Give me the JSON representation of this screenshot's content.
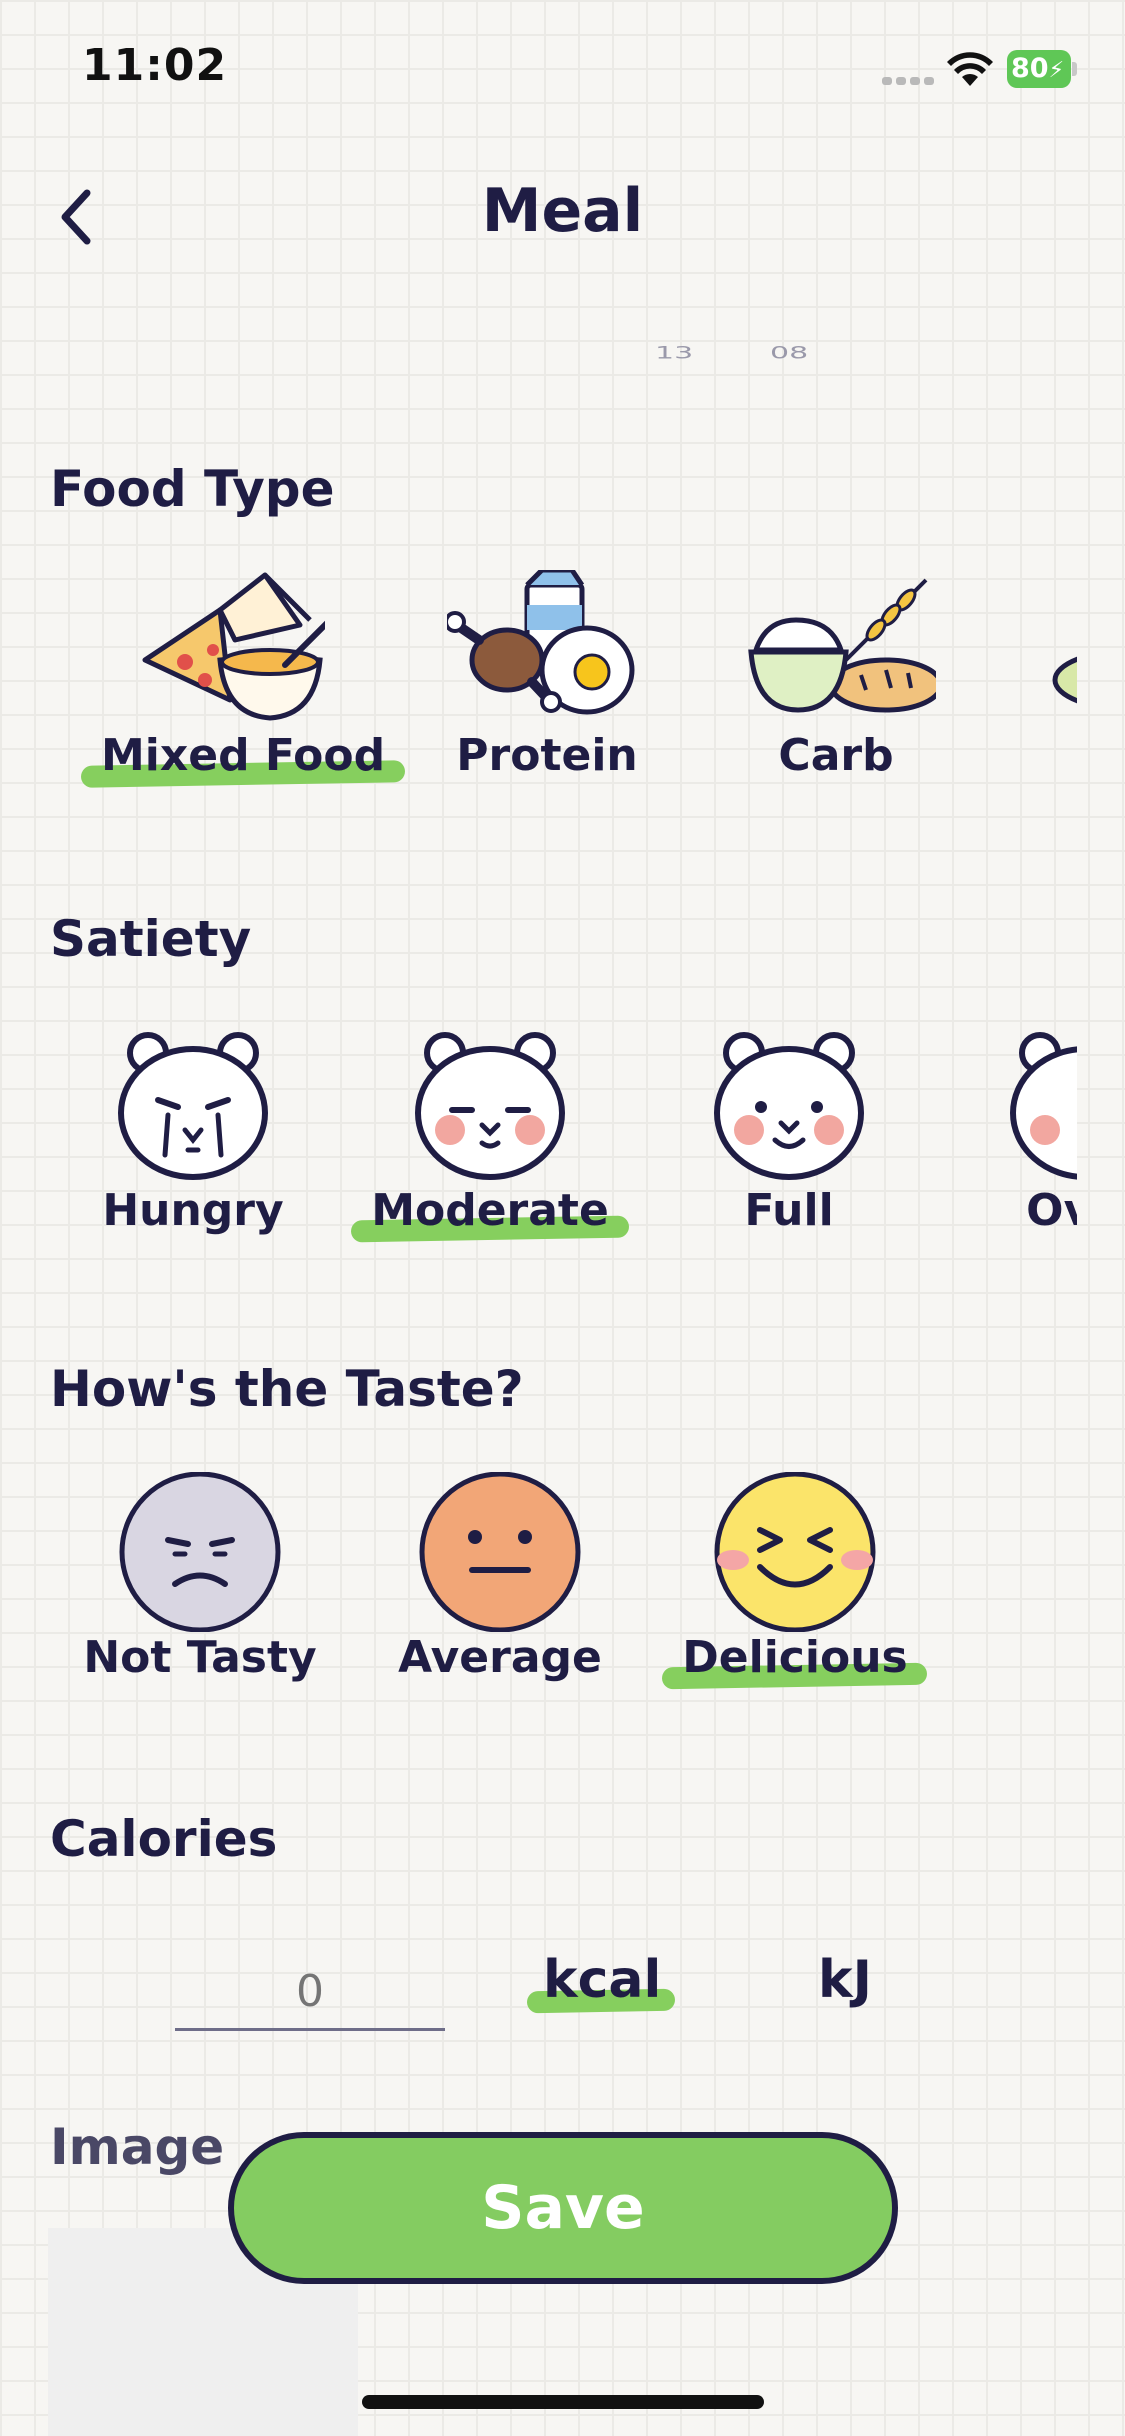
{
  "status_bar": {
    "time": "11:02",
    "battery": "80"
  },
  "nav": {
    "title": "Meal"
  },
  "picker_remnant": {
    "hour": "13",
    "minute": "08"
  },
  "food_type": {
    "title": "Food Type",
    "options": [
      {
        "label": "Mixed Food",
        "icon": "mixed-food-icon",
        "selected": true
      },
      {
        "label": "Protein",
        "icon": "protein-icon",
        "selected": false
      },
      {
        "label": "Carb",
        "icon": "carb-icon",
        "selected": false
      }
    ]
  },
  "satiety": {
    "title": "Satiety",
    "options": [
      {
        "label": "Hungry",
        "icon": "hungry-bear-icon",
        "selected": false
      },
      {
        "label": "Moderate",
        "icon": "moderate-bear-icon",
        "selected": true
      },
      {
        "label": "Full",
        "icon": "full-bear-icon",
        "selected": false
      },
      {
        "label": "Over",
        "icon": "over-bear-icon",
        "selected": false
      }
    ]
  },
  "taste": {
    "title": "How's the Taste?",
    "options": [
      {
        "label": "Not Tasty",
        "icon": "not-tasty-face-icon",
        "selected": false
      },
      {
        "label": "Average",
        "icon": "average-face-icon",
        "selected": false
      },
      {
        "label": "Delicious",
        "icon": "delicious-face-icon",
        "selected": true
      }
    ]
  },
  "calories": {
    "title": "Calories",
    "input_placeholder": "0",
    "units": [
      {
        "label": "kcal",
        "selected": true
      },
      {
        "label": "kJ",
        "selected": false
      }
    ]
  },
  "image_section": {
    "title": "Image"
  },
  "save_label": "Save",
  "colors": {
    "accent_green": "#86cf5e",
    "text_dark": "#1f1d44",
    "save_button": "#84cc61"
  }
}
